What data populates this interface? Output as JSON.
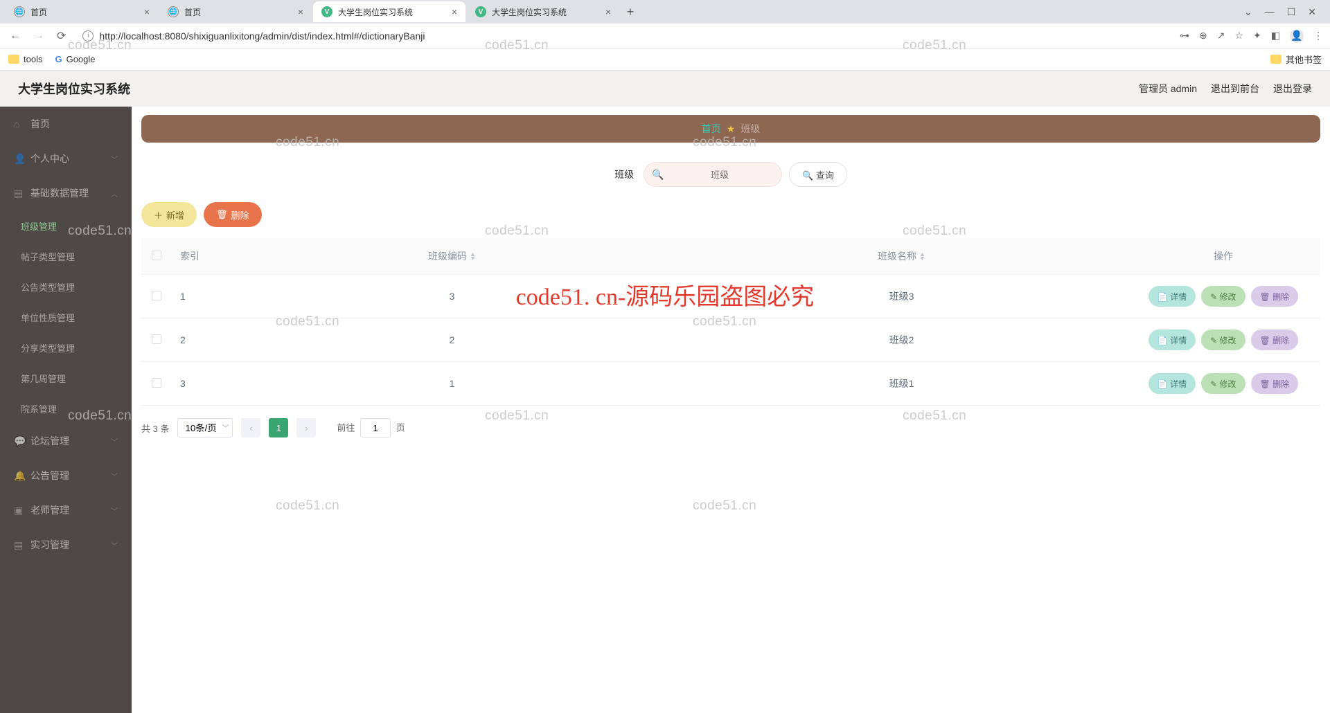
{
  "browser": {
    "tabs": [
      {
        "title": "首页",
        "active": false,
        "icon": "globe"
      },
      {
        "title": "首页",
        "active": false,
        "icon": "globe"
      },
      {
        "title": "大学生岗位实习系统",
        "active": true,
        "icon": "vue"
      },
      {
        "title": "大学生岗位实习系统",
        "active": false,
        "icon": "vue"
      }
    ],
    "url": "http://localhost:8080/shixiguanlixitong/admin/dist/index.html#/dictionaryBanji",
    "bookmarks": {
      "tools": "tools",
      "google": "Google",
      "other": "其他书签"
    }
  },
  "app": {
    "title": "大学生岗位实习系统",
    "user": "管理员 admin",
    "toFront": "退出到前台",
    "logout": "退出登录"
  },
  "menu": {
    "home": "首页",
    "personal": "个人中心",
    "base": "基础数据管理",
    "subs": [
      "班级管理",
      "帖子类型管理",
      "公告类型管理",
      "单位性质管理",
      "分享类型管理",
      "第几周管理",
      "院系管理"
    ],
    "forum": "论坛管理",
    "notice": "公告管理",
    "teacher": "老师管理",
    "intern": "实习管理"
  },
  "breadcrumb": {
    "home": "首页",
    "current": "班级"
  },
  "search": {
    "label": "班级",
    "placeholder": "班级",
    "button": "查询"
  },
  "actions": {
    "add": "新增",
    "delete": "删除"
  },
  "table": {
    "headers": {
      "index": "索引",
      "code": "班级编码",
      "name": "班级名称",
      "ops": "操作"
    },
    "rows": [
      {
        "index": "1",
        "code": "3",
        "name": "班级3"
      },
      {
        "index": "2",
        "code": "2",
        "name": "班级2"
      },
      {
        "index": "3",
        "code": "1",
        "name": "班级1"
      }
    ],
    "rowBtns": {
      "detail": "详情",
      "edit": "修改",
      "delete": "删除"
    }
  },
  "pagination": {
    "total": "共 3 条",
    "pageSize": "10条/页",
    "goto": "前往",
    "page": "1",
    "pageSuffix": "页"
  },
  "overlay": "code51. cn-源码乐园盗图必究",
  "watermark": "code51.cn"
}
